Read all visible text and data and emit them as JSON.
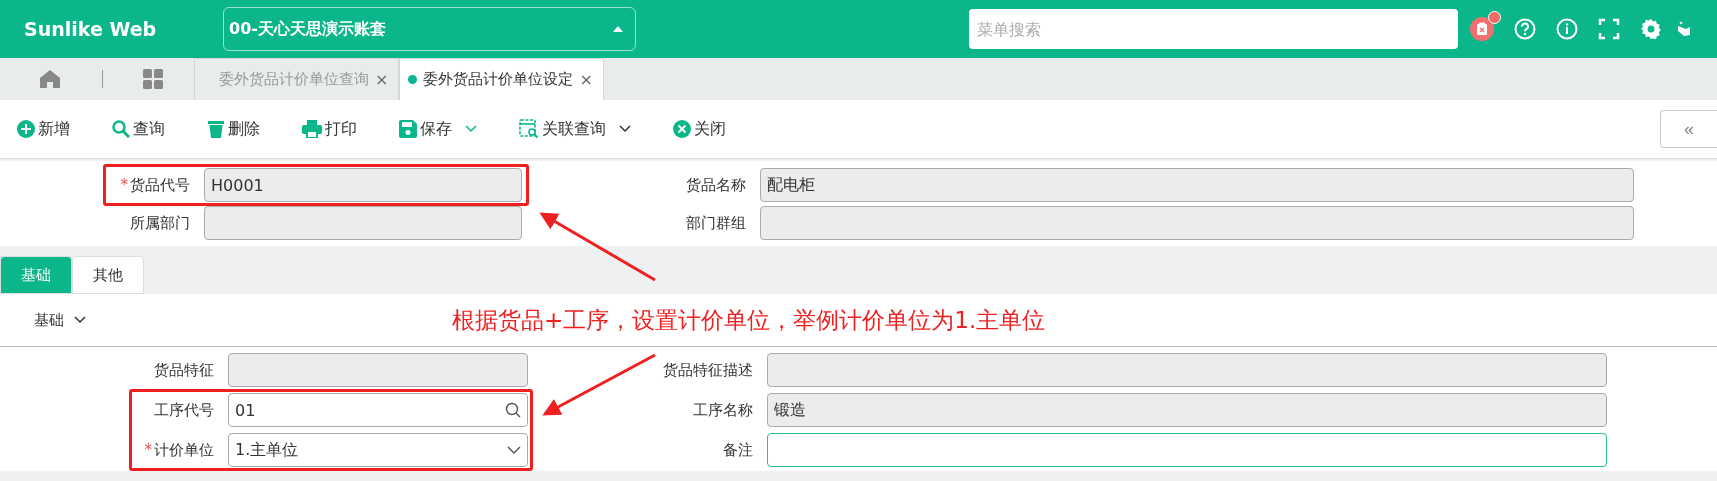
{
  "header": {
    "logo": "Sunlike Web",
    "account": "00-天心天思演示账套",
    "search": {
      "placeholder": "菜单搜索"
    },
    "notification_badge": true
  },
  "tab_bar": {
    "tabs": [
      {
        "label": "委外货品计价单位查询",
        "close": "×",
        "selected": false
      },
      {
        "label": "委外货品计价单位设定",
        "close": "×",
        "selected": true
      }
    ]
  },
  "toolbar": {
    "buttons": [
      {
        "label": "新增",
        "kind": "plus",
        "dropdown": false
      },
      {
        "label": "查询",
        "kind": "search",
        "dropdown": false
      },
      {
        "label": "删除",
        "kind": "trash",
        "dropdown": false
      },
      {
        "label": "打印",
        "kind": "printer",
        "dropdown": false
      },
      {
        "label": "保存",
        "kind": "save",
        "dropdown": true
      },
      {
        "label": "关联查询",
        "kind": "docsearch",
        "dropdown": true
      },
      {
        "label": "关闭",
        "kind": "close",
        "dropdown": false
      }
    ],
    "collapse": "«"
  },
  "header_form": {
    "fields": [
      {
        "required_mark": "*",
        "label": "货品代号",
        "value": "H0001",
        "disabled": true
      },
      {
        "label": "货品名称",
        "value": "配电柜",
        "disabled": true
      },
      {
        "label": "所属部门",
        "disabled": true
      },
      {
        "label": "部门群组",
        "disabled": true
      }
    ]
  },
  "form_tabs": [
    {
      "label": "基础",
      "selected": true
    },
    {
      "label": "其他",
      "selected": false
    }
  ],
  "section": {
    "title": "基础",
    "expanded": true
  },
  "detail_form": {
    "fields": [
      {
        "label": "货品特征",
        "disabled": true,
        "kind": "text"
      },
      {
        "label": "货品特征描述",
        "disabled": true,
        "kind": "text"
      },
      {
        "label": "工序代号",
        "value": "01",
        "disabled": false,
        "kind": "search"
      },
      {
        "label": "工序名称",
        "value": "锻造",
        "disabled": true,
        "kind": "text"
      },
      {
        "required_mark": "*",
        "label": "计价单位",
        "value": "1.主单位",
        "disabled": false,
        "kind": "select"
      },
      {
        "label": "备注",
        "disabled": false,
        "focused": true,
        "kind": "text"
      }
    ]
  },
  "annotation": "根据货品+工序，设置计价单位，举例计价单位为1.主单位"
}
